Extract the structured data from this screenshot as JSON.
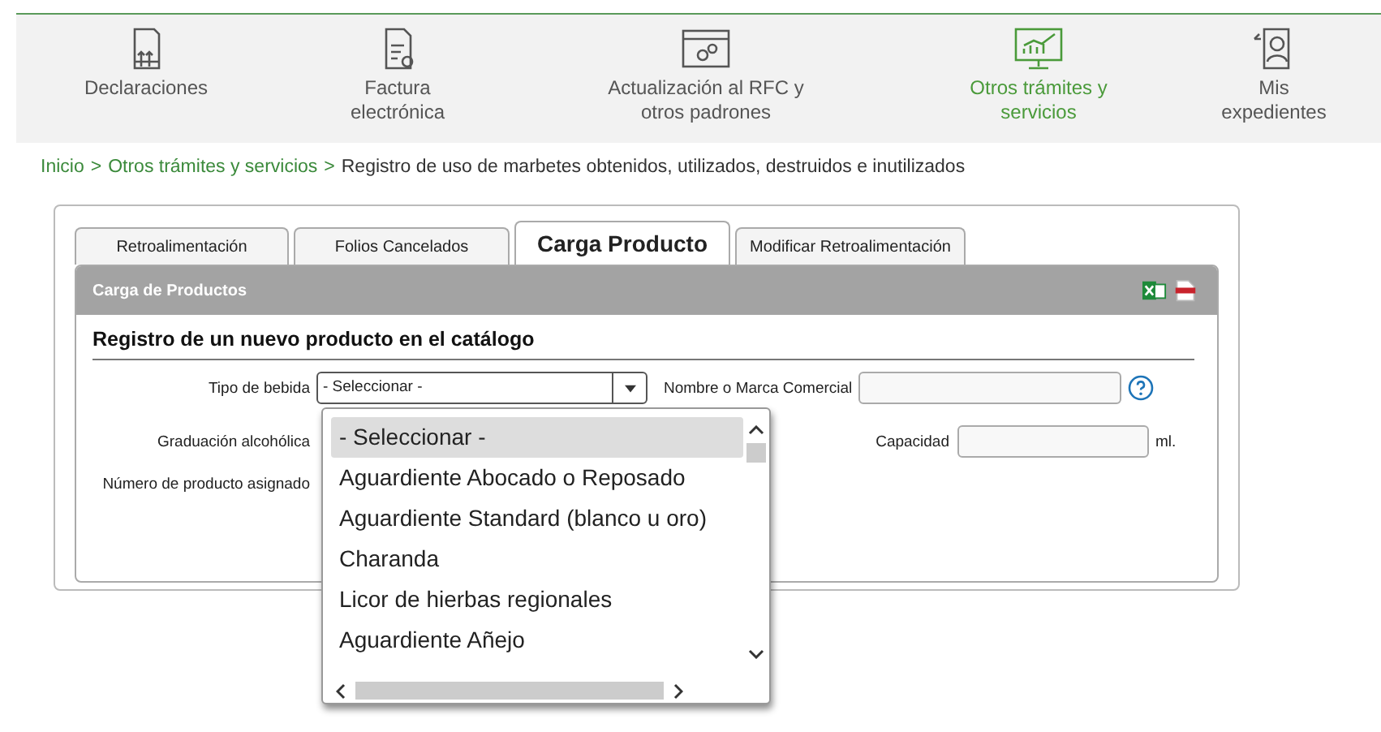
{
  "nav": [
    {
      "label": "Declaraciones",
      "selected": false
    },
    {
      "label": "Factura electrónica",
      "selected": false
    },
    {
      "label": "Actualización al RFC y otros padrones",
      "selected": false
    },
    {
      "label": "Otros trámites y servicios",
      "selected": true
    },
    {
      "label": "Mis expedientes",
      "selected": false
    }
  ],
  "breadcrumb": [
    {
      "label": "Inicio",
      "kind": "link"
    },
    {
      "label": ">",
      "kind": "sep"
    },
    {
      "label": "Otros trámites y servicios",
      "kind": "link"
    },
    {
      "label": ">",
      "kind": "sep"
    },
    {
      "label": "Registro de uso de marbetes obtenidos, utilizados, destruidos e inutilizados",
      "kind": "current"
    }
  ],
  "tabs": [
    {
      "label": "Retroalimentación",
      "selected": false
    },
    {
      "label": "Folios Cancelados",
      "selected": false
    },
    {
      "label": "Carga Producto",
      "selected": true
    },
    {
      "label": "Modificar Retroalimentación",
      "selected": false
    }
  ],
  "panel": {
    "title": "Carga de Productos",
    "heading": "Registro de un nuevo producto en el catálogo"
  },
  "form": {
    "tipo_label": "Tipo de bebida",
    "tipo_value": "- Seleccionar -",
    "nombre_label": "Nombre o Marca Comercial",
    "graduacion_label": "Graduación alcohólica",
    "capacidad_label": "Capacidad",
    "capacidad_unit": "ml.",
    "numero_label": "Número de producto asignado"
  },
  "dropdown": {
    "options": [
      {
        "label": "- Seleccionar -",
        "selected": true
      },
      {
        "label": "Aguardiente Abocado o Reposado",
        "selected": false
      },
      {
        "label": "Aguardiente Standard (blanco u oro)",
        "selected": false
      },
      {
        "label": "Charanda",
        "selected": false
      },
      {
        "label": "Licor de hierbas regionales",
        "selected": false
      },
      {
        "label": "Aguardiente Añejo",
        "selected": false
      }
    ]
  }
}
